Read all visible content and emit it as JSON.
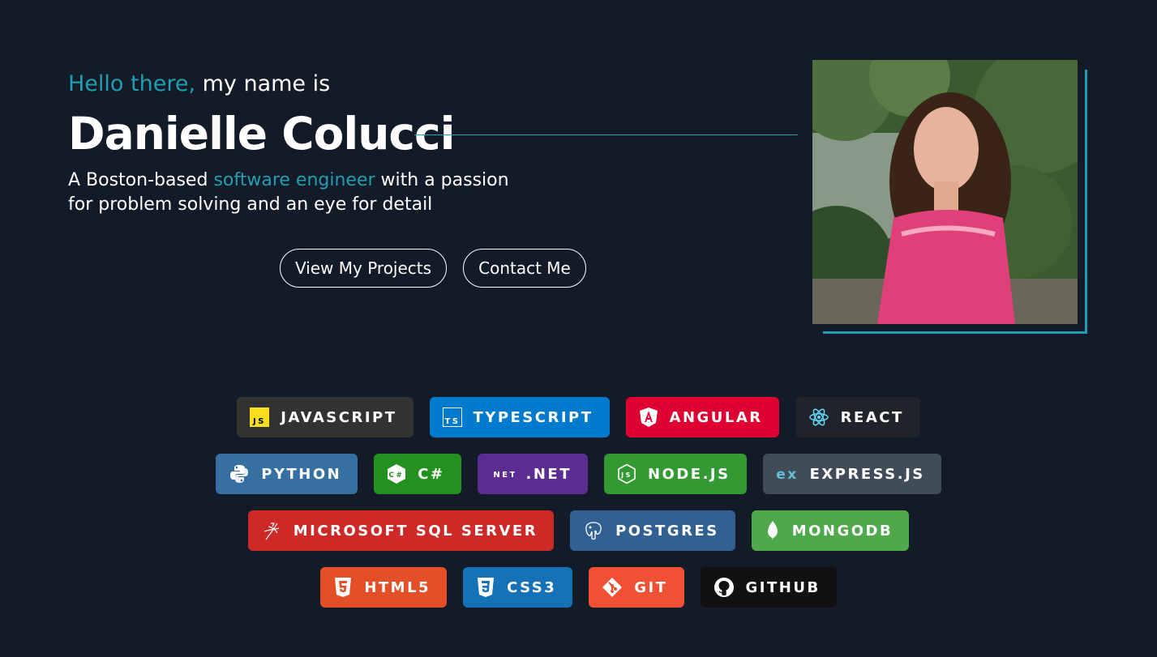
{
  "hero": {
    "greeting_accent": "Hello there,",
    "greeting_rest": " my name is",
    "name": "Danielle Colucci",
    "tagline_pre": "A Boston-based ",
    "tagline_accent": "software engineer",
    "tagline_post": " with a passion for problem solving and an eye for detail",
    "buttons": {
      "projects": "View My Projects",
      "contact": "Contact Me"
    }
  },
  "colors": {
    "background": "#121b27",
    "accent": "#1f9fb0"
  },
  "skills": [
    [
      {
        "label": "JAVASCRIPT",
        "icon": "javascript-icon",
        "color": "#323330"
      },
      {
        "label": "TYPESCRIPT",
        "icon": "typescript-icon",
        "color": "#007acc"
      },
      {
        "label": "ANGULAR",
        "icon": "angular-icon",
        "color": "#dd0031"
      },
      {
        "label": "REACT",
        "icon": "react-icon",
        "color": "#20232a"
      }
    ],
    [
      {
        "label": "PYTHON",
        "icon": "python-icon",
        "color": "#3670a0"
      },
      {
        "label": "C#",
        "icon": "csharp-icon",
        "color": "#239120"
      },
      {
        "label": ".NET",
        "icon": "dotnet-icon",
        "color": "#5c2d91"
      },
      {
        "label": "NODE.JS",
        "icon": "nodejs-icon",
        "color": "#339933"
      },
      {
        "label": "EXPRESS.JS",
        "icon": "express-icon",
        "color": "#404d59"
      }
    ],
    [
      {
        "label": "MICROSOFT SQL SERVER",
        "icon": "sqlserver-icon",
        "color": "#cc2927"
      },
      {
        "label": "POSTGRES",
        "icon": "postgres-icon",
        "color": "#316192"
      },
      {
        "label": "MONGODB",
        "icon": "mongodb-icon",
        "color": "#4ea94b"
      }
    ],
    [
      {
        "label": "HTML5",
        "icon": "html5-icon",
        "color": "#e34f26"
      },
      {
        "label": "CSS3",
        "icon": "css3-icon",
        "color": "#1572b6"
      },
      {
        "label": "GIT",
        "icon": "git-icon",
        "color": "#f05033"
      },
      {
        "label": "GITHUB",
        "icon": "github-icon",
        "color": "#121011"
      }
    ]
  ]
}
